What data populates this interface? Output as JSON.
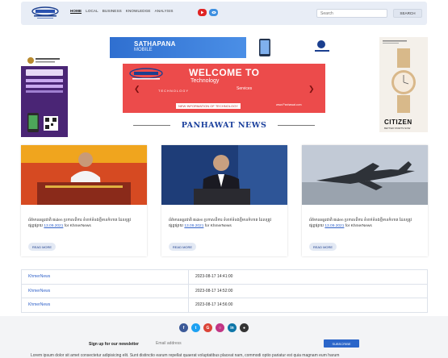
{
  "header": {
    "nav": [
      "HOME",
      "LOCAL",
      "BUSINESS",
      "KNOWLEDGE",
      "ANALYSIS"
    ],
    "search_placeholder": "Search",
    "search_label": "SEARCH"
  },
  "ads": {
    "top_banner_line1": "SATHAPANA",
    "top_banner_line2": "MOBILE",
    "right_brand": "CITIZEN",
    "right_tagline": "BETTER STARTS NOW"
  },
  "slider": {
    "welcome": "WELCOME TO",
    "technology": "Technology",
    "services": "Services",
    "technology_small": "TECHNOLOGY",
    "new_info": "NEW INFORMATION OF TECHNOLOGY",
    "site": "www.Panhawat.com"
  },
  "section_title": "PANHAWAT NEWS",
  "cards": [
    {
      "text": "ព័ត៌មានអន្តរជាតិ Biden ប្រកាសពីការ ទំនាក់ទំនង​ថ្មី​មានកំហាត ​ដែលត្រូវ​ផ្សព្វផ្សាយ",
      "date": "13.09.2021",
      "for": "for",
      "source": "KhmerNews",
      "more": "READ MORE"
    },
    {
      "text": "ព័ត៌មានអន្តរជាតិ Biden ប្រកាសពីការ ទំនាក់ទំនង​ថ្មី​មានកំហាត ​ដែលត្រូវ​ផ្សព្វផ្សាយ",
      "date": "13.09.2021",
      "for": "for",
      "source": "KhmerNews",
      "more": "READ MORE"
    },
    {
      "text": "ព័ត៌មានអន្តរជាតិ Biden ប្រកាសពីការ ទំនាក់ទំនង​ថ្មី​មានកំហាត ​ដែលត្រូវ​ផ្សព្វផ្សាយ",
      "date": "13.09.2021",
      "for": "for",
      "source": "KhmerNews",
      "more": "READ MORE"
    }
  ],
  "table": [
    {
      "source": "KhmerNews",
      "time": "2023-08-17 14:41:00"
    },
    {
      "source": "KhmerNews",
      "time": "2023-08-17 14:52:00"
    },
    {
      "source": "KhmerNews",
      "time": "2023-08-17 14:56:00"
    }
  ],
  "footer": {
    "newsletter_label": "Sign up for our newsletter",
    "email_placeholder": "Email address",
    "subscribe": "SUBSCRIBE",
    "lorem": "Lorem ipsum dolor sit amet consectetur adipisicing elit. Sunt distinctio earum repellat quaerat voluptatibus placeat nam, commodi optio pariatur est quia magnam eum harum"
  },
  "colors": {
    "accent": "#1a3f9c",
    "slider_bg": "#ec4b4b",
    "subscribe": "#2b66c9"
  }
}
